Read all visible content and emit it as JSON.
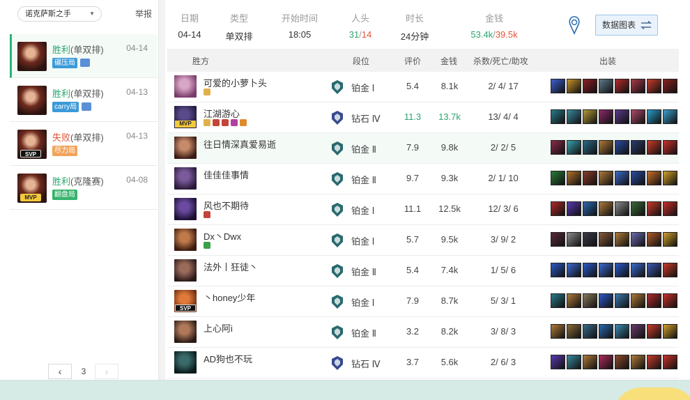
{
  "left": {
    "champion_select": "诺克萨斯之手",
    "report_label": "举报",
    "matches": [
      {
        "result": "胜利",
        "queue": "(单双排)",
        "date": "04-14",
        "badge": "碾压局",
        "badge_color": "blue",
        "has_image_icon": true,
        "avatar_tag": "",
        "active": true,
        "outcome": "win"
      },
      {
        "result": "胜利",
        "queue": "(单双排)",
        "date": "04-13",
        "badge": "carry局",
        "badge_color": "blue",
        "has_image_icon": true,
        "avatar_tag": "",
        "active": false,
        "outcome": "win"
      },
      {
        "result": "失败",
        "queue": "(单双排)",
        "date": "04-13",
        "badge": "尽力局",
        "badge_color": "orange",
        "has_image_icon": false,
        "avatar_tag": "SVP",
        "active": false,
        "outcome": "lose"
      },
      {
        "result": "胜利",
        "queue": "(克隆赛)",
        "date": "04-08",
        "badge": "翻盘局",
        "badge_color": "green",
        "has_image_icon": false,
        "avatar_tag": "MVP",
        "active": false,
        "outcome": "win"
      }
    ],
    "pager": {
      "prev": "‹",
      "page": "3",
      "next": "›"
    }
  },
  "summary": {
    "date_label": "日期",
    "date": "04-14",
    "type_label": "类型",
    "type": "单双排",
    "start_label": "开始时间",
    "start": "18:05",
    "kills_label": "人头",
    "kills_win": "31",
    "kills_lose": "14",
    "duration_label": "时长",
    "duration": "24分钟",
    "gold_label": "金钱",
    "gold_win": "53.4k",
    "gold_lose": "39.5k",
    "chart_button": "数据图表"
  },
  "table": {
    "headers": {
      "side": "胜方",
      "rank": "段位",
      "score": "评价",
      "gold": "金钱",
      "kda": "杀数/死亡/助攻",
      "items": "出装"
    },
    "rows": [
      {
        "name": "可爱的小萝卜头",
        "rank": "铂金 Ⅰ",
        "rank_tier": "plat",
        "score": "5.4",
        "gold": "8.1k",
        "kda": "2/ 4/ 17",
        "tag": "",
        "self": false,
        "highlight": false,
        "badges": [
          "#e0b04a"
        ],
        "avatar": [
          "#d8a6c6",
          "#7a3a6a"
        ],
        "items": [
          "#3a5fd0",
          "#c9912a",
          "#8a1f22",
          "#5d7a8a",
          "#b52a2a",
          "#a83a4a",
          "#c93a2a",
          "#8a2222"
        ]
      },
      {
        "name": "江湖游心",
        "rank": "钻石 Ⅳ",
        "rank_tier": "diamond",
        "score": "11.3",
        "gold": "13.7k",
        "kda": "13/ 4/ 4",
        "tag": "MVP",
        "self": false,
        "highlight": true,
        "badges": [
          "#e0b04a",
          "#c4443a",
          "#c4443a",
          "#b040a0",
          "#e08a2a"
        ],
        "avatar": [
          "#5a4a8a",
          "#1a1a3a"
        ],
        "items": [
          "#2a7a8a",
          "#3a8aa0",
          "#b59a3a",
          "#8a2a6a",
          "#5a3a8a",
          "#b04a6a",
          "#2a9ac9",
          "#3aa0d0"
        ]
      },
      {
        "name": "往日情深真爱易逝",
        "rank": "铂金 Ⅱ",
        "rank_tier": "plat",
        "score": "7.9",
        "gold": "9.8k",
        "kda": "2/ 2/ 5",
        "tag": "",
        "self": true,
        "highlight": false,
        "badges": [],
        "avatar": [
          "#c78a6a",
          "#3a1a14"
        ],
        "items": [
          "#8a2a4a",
          "#3aa0b0",
          "#2a6a8a",
          "#b07a3a",
          "#2a4aa0",
          "#2a3a6a",
          "#c93a2a",
          "#c9302a"
        ]
      },
      {
        "name": "佳佳佳事情",
        "rank": "铂金 Ⅱ",
        "rank_tier": "plat",
        "score": "9.7",
        "gold": "9.3k",
        "kda": "2/ 1/ 10",
        "tag": "",
        "self": false,
        "highlight": false,
        "badges": [],
        "avatar": [
          "#7a5a9a",
          "#2a1a3a"
        ],
        "items": [
          "#2a7a3a",
          "#b0702a",
          "#8a3a2a",
          "#b07a3a",
          "#3a6ac9",
          "#2a4aa0",
          "#c9702a",
          "#d0a02a"
        ]
      },
      {
        "name": "风也不期待",
        "rank": "铂金 Ⅰ",
        "rank_tier": "plat",
        "score": "11.1",
        "gold": "12.5k",
        "kda": "12/ 3/ 6",
        "tag": "",
        "self": false,
        "highlight": false,
        "badges": [
          "#c4443a"
        ],
        "avatar": [
          "#6a4aa0",
          "#1a1030"
        ],
        "items": [
          "#b02a2a",
          "#5a3ab0",
          "#2a6ab0",
          "#b07a3a",
          "#8a8a8a",
          "#3a6a3a",
          "#c93a2a",
          "#c9302a"
        ]
      },
      {
        "name": "Dx丶Dwx",
        "rank": "铂金 Ⅰ",
        "rank_tier": "plat",
        "score": "5.7",
        "gold": "9.5k",
        "kda": "3/ 9/ 2",
        "tag": "",
        "self": false,
        "highlight": false,
        "badges": [
          "#3aa04a"
        ],
        "avatar": [
          "#c07a4a",
          "#3a1a10"
        ],
        "items": [
          "#5a2a3a",
          "#8a8a8a",
          "#3a3a4a",
          "#8a5a3a",
          "#b07a3a",
          "#6a6ab0",
          "#b05a2a",
          "#d0a02a"
        ]
      },
      {
        "name": "法外丨狂徒丶",
        "rank": "铂金 Ⅱ",
        "rank_tier": "plat",
        "score": "5.4",
        "gold": "7.4k",
        "kda": "1/ 5/ 6",
        "tag": "",
        "self": false,
        "highlight": false,
        "badges": [],
        "avatar": [
          "#9a6a5a",
          "#2a1a1a"
        ],
        "items": [
          "#2a5ac9",
          "#3a6ad0",
          "#2a5ac9",
          "#3a6ad0",
          "#2a5ac9",
          "#3a6ad0",
          "#3a5ab0",
          "#c93a2a"
        ]
      },
      {
        "name": "丶honey少年",
        "rank": "铂金 Ⅰ",
        "rank_tier": "plat",
        "score": "7.9",
        "gold": "8.7k",
        "kda": "5/ 3/ 1",
        "tag": "SVP",
        "self": false,
        "highlight": false,
        "badges": [],
        "avatar": [
          "#e07a3a",
          "#6a2a10"
        ],
        "items": [
          "#2a7a8a",
          "#b07a3a",
          "#8a7a5a",
          "#2a5ac9",
          "#3a7ab0",
          "#b07a3a",
          "#b02a2a",
          "#c9302a"
        ]
      },
      {
        "name": "上心阿i",
        "rank": "铂金 Ⅱ",
        "rank_tier": "plat",
        "score": "3.2",
        "gold": "8.2k",
        "kda": "3/ 8/ 3",
        "tag": "",
        "self": false,
        "highlight": false,
        "badges": [],
        "avatar": [
          "#b07a5a",
          "#2a1a14"
        ],
        "items": [
          "#b07a3a",
          "#8a6a3a",
          "#3a6a8a",
          "#2a6ab0",
          "#3a8ab0",
          "#6a3a6a",
          "#c93a2a",
          "#d0a02a"
        ]
      },
      {
        "name": "AD狗也不玩",
        "rank": "钻石 Ⅳ",
        "rank_tier": "diamond",
        "score": "3.7",
        "gold": "5.6k",
        "kda": "2/ 6/ 3",
        "tag": "",
        "self": false,
        "highlight": false,
        "badges": [],
        "avatar": [
          "#3a6a6a",
          "#0a1a1a"
        ],
        "items": [
          "#5a3ab0",
          "#3a8aa0",
          "#b07a3a",
          "#b02a5a",
          "#8a4a2a",
          "#b07a3a",
          "#c93a2a",
          "#c9302a"
        ]
      }
    ]
  }
}
